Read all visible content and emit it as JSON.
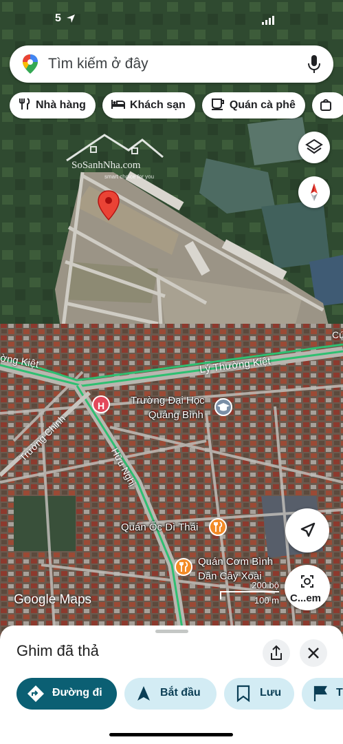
{
  "status_bar": {
    "time": "5",
    "signal": "signal-icon"
  },
  "search": {
    "placeholder": "Tìm kiếm ở đây"
  },
  "chips": [
    {
      "label": "Nhà hàng",
      "icon": "restaurant-icon"
    },
    {
      "label": "Khách sạn",
      "icon": "hotel-icon"
    },
    {
      "label": "Quán cà phê",
      "icon": "cafe-icon"
    }
  ],
  "watermark": {
    "brand": "SoSanhNha.com",
    "tagline": "smart choice for you"
  },
  "map_labels": {
    "road_ly_thuong_kiet": "Lý Thường Kiệt",
    "road_left": "ờng Kiệt",
    "road_truong_chinh": "Trường Chinh",
    "road_huu_nghi": "Hữu Nghị",
    "edge_right": "Cú",
    "university_line1": "Trường Đại Học",
    "university_line2": "Quảng Bình",
    "poi_oc": "Quán Ốc Dì Thái",
    "poi_com_line1": "Quán Cơm Bình",
    "poi_com_line2": "Dân Cây Xoài",
    "hospital": "H"
  },
  "scale": {
    "feet": "200 bộ",
    "meters": "100 m"
  },
  "attribution": "Google Maps",
  "camera_button": "C...em",
  "sheet": {
    "title": "Ghim đã thả",
    "actions": [
      {
        "label": "Đường đi",
        "icon": "directions-icon"
      },
      {
        "label": "Bắt đầu",
        "icon": "navigation-icon"
      },
      {
        "label": "Lưu",
        "icon": "bookmark-icon"
      },
      {
        "label": "T",
        "icon": "flag-icon"
      }
    ]
  },
  "colors": {
    "accent": "#0b57d0",
    "route": "#2fbf71",
    "pin": "#ea4335",
    "chip_bg": "#d3ecf4"
  }
}
